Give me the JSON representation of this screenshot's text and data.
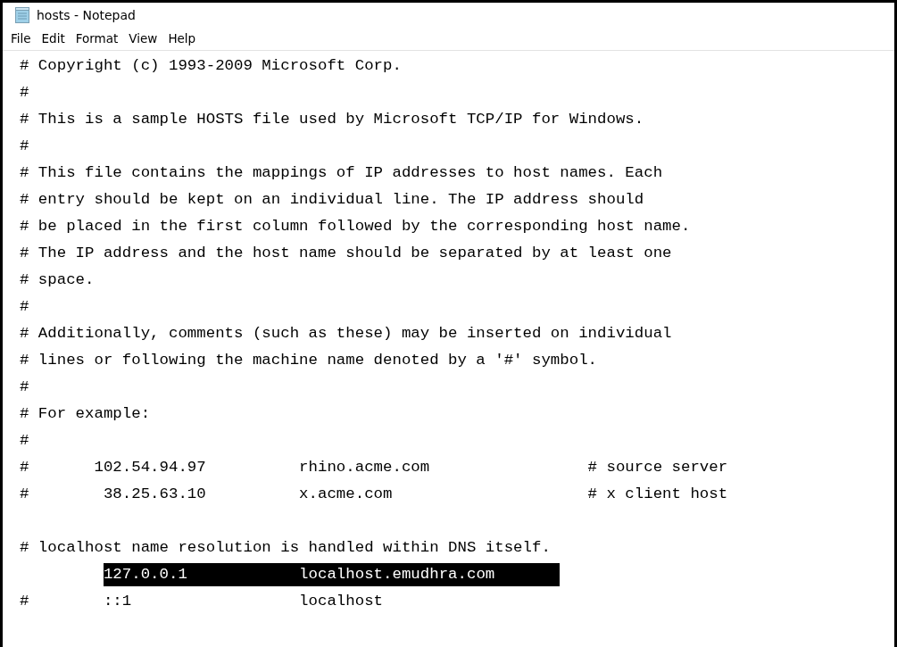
{
  "window": {
    "title": "hosts - Notepad"
  },
  "menu": [
    "File",
    "Edit",
    "Format",
    "View",
    "Help"
  ],
  "lines": [
    {
      "kind": "text",
      "text": "# Copyright (c) 1993-2009 Microsoft Corp.",
      "selected": false
    },
    {
      "kind": "text",
      "text": "#",
      "selected": false
    },
    {
      "kind": "text",
      "text": "# This is a sample HOSTS file used by Microsoft TCP/IP for Windows.",
      "selected": false
    },
    {
      "kind": "text",
      "text": "#",
      "selected": false
    },
    {
      "kind": "text",
      "text": "# This file contains the mappings of IP addresses to host names. Each",
      "selected": false
    },
    {
      "kind": "text",
      "text": "# entry should be kept on an individual line. The IP address should",
      "selected": false
    },
    {
      "kind": "text",
      "text": "# be placed in the first column followed by the corresponding host name.",
      "selected": false
    },
    {
      "kind": "text",
      "text": "# The IP address and the host name should be separated by at least one",
      "selected": false
    },
    {
      "kind": "text",
      "text": "# space.",
      "selected": false
    },
    {
      "kind": "text",
      "text": "#",
      "selected": false
    },
    {
      "kind": "text",
      "text": "# Additionally, comments (such as these) may be inserted on individual",
      "selected": false
    },
    {
      "kind": "text",
      "text": "# lines or following the machine name denoted by a '#' symbol.",
      "selected": false
    },
    {
      "kind": "text",
      "text": "#",
      "selected": false
    },
    {
      "kind": "text",
      "text": "# For example:",
      "selected": false
    },
    {
      "kind": "text",
      "text": "#",
      "selected": false
    },
    {
      "kind": "text",
      "text": "#       102.54.94.97          rhino.acme.com                 # source server",
      "selected": false
    },
    {
      "kind": "text",
      "text": "#        38.25.63.10          x.acme.com                     # x client host",
      "selected": false
    },
    {
      "kind": "blank"
    },
    {
      "kind": "text",
      "text": "# localhost name resolution is handled within DNS itself.",
      "selected": false
    },
    {
      "kind": "text",
      "text": "         127.0.0.1            localhost.emudhra.com",
      "selected": true
    },
    {
      "kind": "text",
      "text": "#        ::1                  localhost",
      "selected": false
    }
  ]
}
